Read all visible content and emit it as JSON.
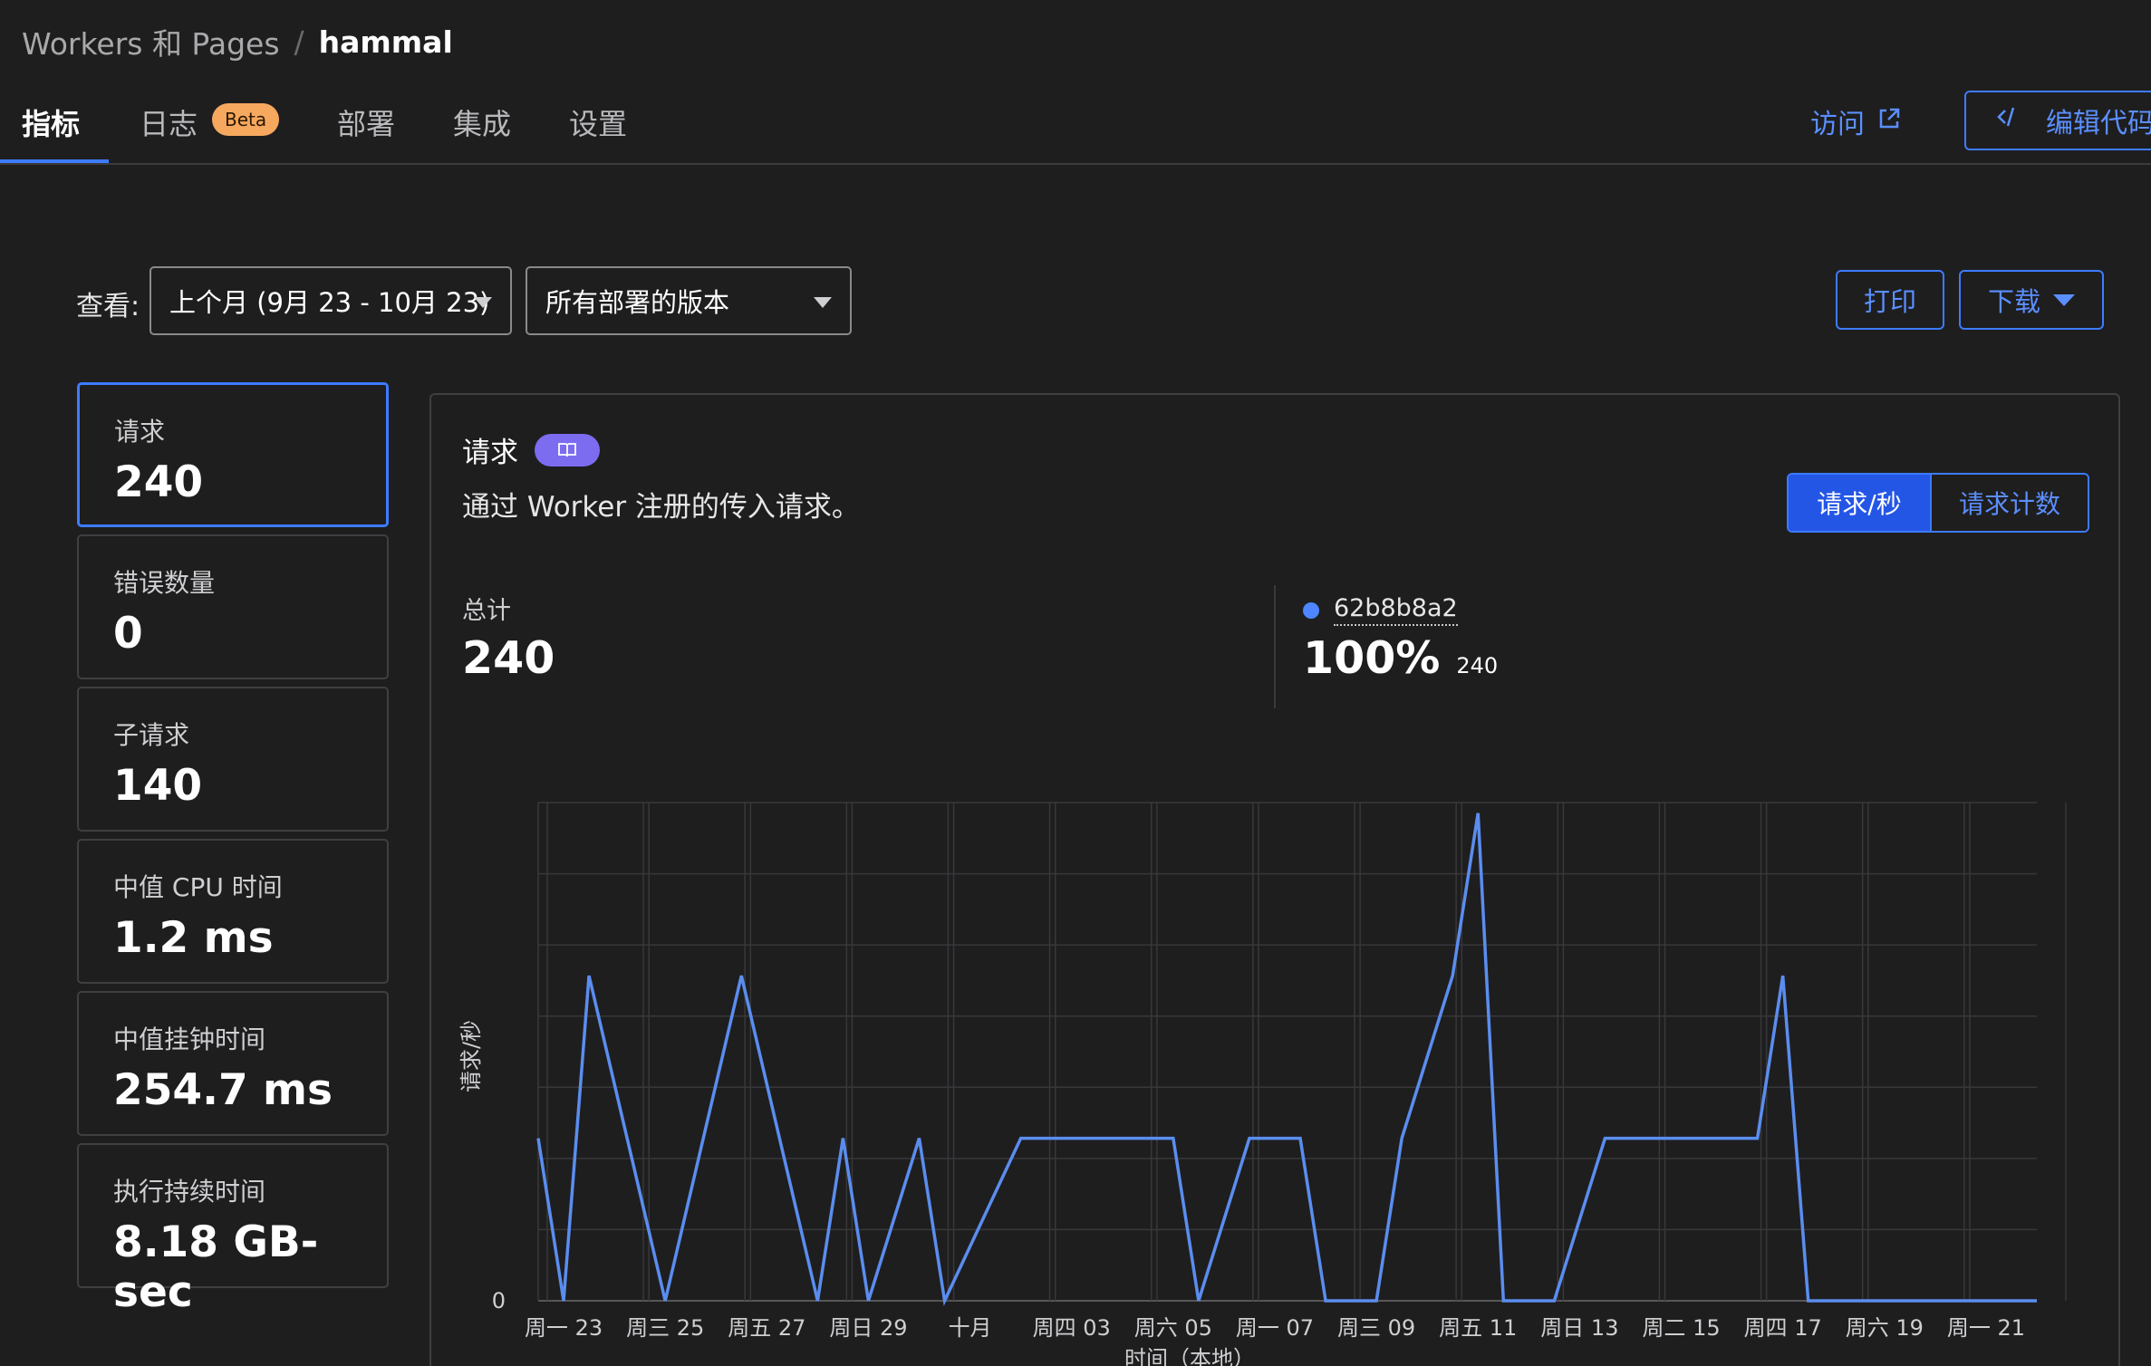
{
  "breadcrumb": {
    "parent": "Workers 和 Pages",
    "separator": "/",
    "current": "hammal"
  },
  "tabs": [
    {
      "label": "指标",
      "active": true
    },
    {
      "label": "日志",
      "badge": "Beta"
    },
    {
      "label": "部署"
    },
    {
      "label": "集成"
    },
    {
      "label": "设置"
    }
  ],
  "header_actions": {
    "visit": "访问",
    "edit_code": "编辑代码"
  },
  "filters": {
    "view_label": "查看:",
    "period": "上个月 (9月 23 - 10月 23)",
    "version": "所有部署的版本",
    "print": "打印",
    "download": "下载"
  },
  "metrics": [
    {
      "label": "请求",
      "value": "240",
      "active": true
    },
    {
      "label": "错误数量",
      "value": "0"
    },
    {
      "label": "子请求",
      "value": "140"
    },
    {
      "label": "中值 CPU 时间",
      "value": "1.2 ms"
    },
    {
      "label": "中值挂钟时间",
      "value": "254.7 ms"
    },
    {
      "label": "执行持续时间",
      "value": "8.18 GB-sec"
    }
  ],
  "panel": {
    "title": "请求",
    "description": "通过 Worker 注册的传入请求。",
    "toggle": {
      "rate": "请求/秒",
      "count": "请求计数"
    },
    "total_label": "总计",
    "total_value": "240",
    "version_id": "62b8b8a2",
    "version_pct": "100%",
    "version_count": "240"
  },
  "colors": {
    "accent": "#3d7bff",
    "line": "#5b8def",
    "badge": "#f6a85e",
    "doc_pill": "#7b6cf0"
  },
  "chart_data": {
    "type": "line",
    "ylabel": "请求/秒",
    "xlabel": "时间（本地）",
    "ytick_labels": [
      "0"
    ],
    "xtick_labels": [
      "周一 23",
      "周三 25",
      "周五 27",
      "周日 29",
      "十月",
      "周四 03",
      "周六 05",
      "周一 07",
      "周三 09",
      "周五 11",
      "周日 13",
      "周二 15",
      "周四 17",
      "周六 19",
      "周一 21"
    ],
    "grid": true,
    "series": [
      {
        "name": "62b8b8a2",
        "x": [
          "2024-09-22T12:00",
          "2024-09-23T00:00",
          "2024-09-23T12:00",
          "2024-09-25T00:00",
          "2024-09-26T12:00",
          "2024-09-28T00:00",
          "2024-09-28T12:00",
          "2024-09-29T00:00",
          "2024-09-30T00:00",
          "2024-09-30T12:00",
          "2024-10-02T00:00",
          "2024-10-02T12:00",
          "2024-10-03T00:00",
          "2024-10-04T00:00",
          "2024-10-05T00:00",
          "2024-10-05T12:00",
          "2024-10-06T12:00",
          "2024-10-07T00:00",
          "2024-10-07T12:00",
          "2024-10-08T00:00",
          "2024-10-09T00:00",
          "2024-10-09T12:00",
          "2024-10-10T12:00",
          "2024-10-11T00:00",
          "2024-10-11T12:00",
          "2024-10-12T00:00",
          "2024-10-12T12:00",
          "2024-10-13T12:00",
          "2024-10-14T00:00",
          "2024-10-15T00:00",
          "2024-10-15T12:00",
          "2024-10-16T12:00",
          "2024-10-17T00:00",
          "2024-10-17T12:00",
          "2024-10-19T00:00",
          "2024-10-19T12:00",
          "2024-10-20T00:00",
          "2024-10-20T12:00",
          "2024-10-22T00:00"
        ],
        "values": [
          2.3e-05,
          0,
          4.6e-05,
          0,
          4.6e-05,
          0,
          2.3e-05,
          0,
          2.3e-05,
          0,
          2.3e-05,
          2.3e-05,
          2.3e-05,
          2.3e-05,
          2.3e-05,
          0,
          2.3e-05,
          2.3e-05,
          2.3e-05,
          0,
          0,
          2.3e-05,
          4.6e-05,
          6.9e-05,
          0,
          0,
          0,
          2.3e-05,
          2.3e-05,
          2.3e-05,
          2.3e-05,
          2.3e-05,
          4.6e-05,
          0,
          0,
          0,
          0,
          0,
          0
        ]
      }
    ]
  }
}
